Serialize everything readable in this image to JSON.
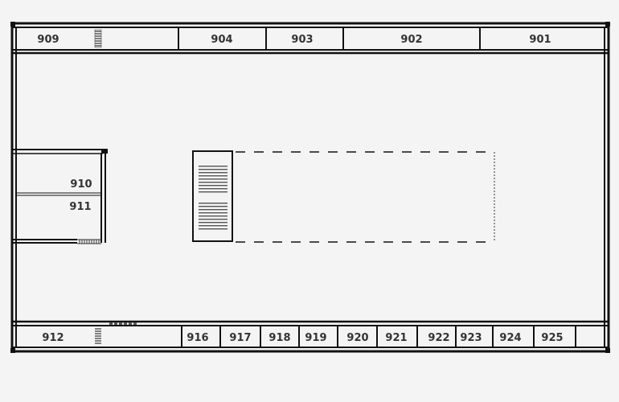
{
  "floor_plan": {
    "top_rooms": [
      "909",
      "904",
      "903",
      "902",
      "901"
    ],
    "left_rooms": [
      "910",
      "911"
    ],
    "bottom_rooms": [
      "912",
      "916",
      "917",
      "918",
      "919",
      "920",
      "921",
      "922",
      "923",
      "924",
      "925"
    ]
  }
}
